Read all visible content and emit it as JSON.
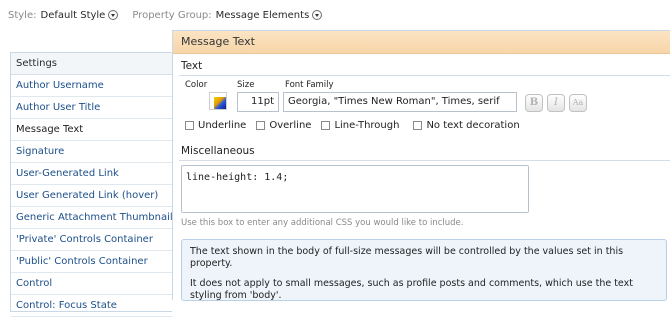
{
  "topbar": {
    "style_label": "Style:",
    "style_value": "Default Style",
    "group_label": "Property Group:",
    "group_value": "Message Elements"
  },
  "sidebar": {
    "header": "Settings",
    "items": [
      {
        "label": "Author Username"
      },
      {
        "label": "Author User Title"
      },
      {
        "label": "Message Text"
      },
      {
        "label": "Signature"
      },
      {
        "label": "User-Generated Link"
      },
      {
        "label": "User Generated Link (hover)"
      },
      {
        "label": "Generic Attachment Thumbnail"
      },
      {
        "label": "'Private' Controls Container"
      },
      {
        "label": "'Public' Controls Container"
      },
      {
        "label": "Control"
      },
      {
        "label": "Control: Focus State"
      }
    ],
    "active_index": 2
  },
  "panel": {
    "title": "Message Text",
    "text_section": "Text",
    "labels": {
      "color": "Color",
      "size": "Size",
      "font_family": "Font Family"
    },
    "size_value": "11pt",
    "font_family_value": "Georgia, \"Times New Roman\", Times, serif",
    "format_buttons": {
      "bold": "B",
      "italic": "I",
      "caps": "Aa"
    },
    "decorations": [
      {
        "label": "Underline"
      },
      {
        "label": "Overline"
      },
      {
        "label": "Line-Through"
      },
      {
        "label": "No text decoration"
      }
    ],
    "misc_section": "Miscellaneous",
    "css_value": "line-height: 1.4;",
    "css_hint": "Use this box to enter any additional CSS you would like to include.",
    "info": {
      "line1": "The text shown in the body of full-size messages will be controlled by the values set in this property.",
      "line2": "It does not apply to small messages, such as profile posts and comments, which use the text styling from 'body'."
    }
  },
  "colors": {
    "header_bg": "#f7d5a8",
    "link": "#1c4f8a",
    "info_bg": "#eef4fa"
  }
}
